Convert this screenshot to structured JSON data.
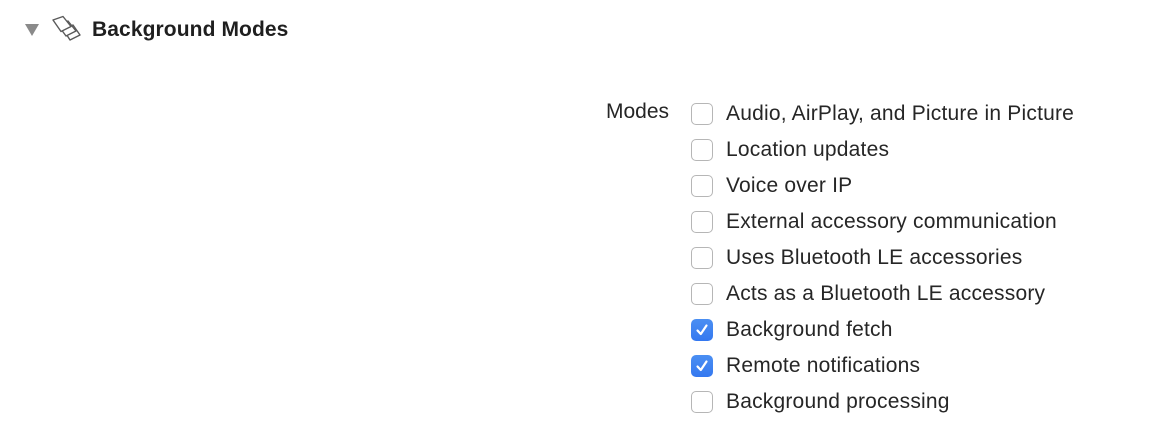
{
  "section": {
    "title": "Background Modes",
    "expanded": true,
    "icon": "stacked-layers-icon",
    "disclosure_icon": "disclosure-triangle-down-icon"
  },
  "modes_label": "Modes",
  "modes": [
    {
      "label": "Audio, AirPlay, and Picture in Picture",
      "checked": false
    },
    {
      "label": "Location updates",
      "checked": false
    },
    {
      "label": "Voice over IP",
      "checked": false
    },
    {
      "label": "External accessory communication",
      "checked": false
    },
    {
      "label": "Uses Bluetooth LE accessories",
      "checked": false
    },
    {
      "label": "Acts as a Bluetooth LE accessory",
      "checked": false
    },
    {
      "label": "Background fetch",
      "checked": true
    },
    {
      "label": "Remote notifications",
      "checked": true
    },
    {
      "label": "Background processing",
      "checked": false
    }
  ],
  "colors": {
    "checkbox_checked": "#3b82f1",
    "checkbox_border": "#b6b6b6",
    "text": "#262626"
  }
}
